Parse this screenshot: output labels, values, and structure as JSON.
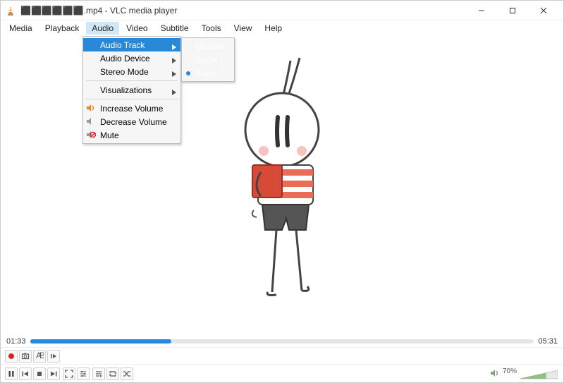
{
  "titlebar": {
    "filename_masked": "⬛⬛⬛⬛⬛⬛.mp4",
    "app_name": "VLC media player"
  },
  "menus": {
    "items": [
      "Media",
      "Playback",
      "Audio",
      "Video",
      "Subtitle",
      "Tools",
      "View",
      "Help"
    ],
    "open_index": 2
  },
  "audio_menu": {
    "items": [
      {
        "label": "Audio Track",
        "submenu": true,
        "highlight": true,
        "icon": null
      },
      {
        "label": "Audio Device",
        "submenu": true,
        "icon": null
      },
      {
        "label": "Stereo Mode",
        "submenu": true,
        "icon": null
      },
      {
        "sep": true
      },
      {
        "label": "Visualizations",
        "submenu": true,
        "icon": null
      },
      {
        "sep": true
      },
      {
        "label": "Increase Volume",
        "icon": "volume-up"
      },
      {
        "label": "Decrease Volume",
        "icon": "volume-down"
      },
      {
        "label": "Mute",
        "icon": "mute"
      }
    ]
  },
  "audio_track_submenu": {
    "items": [
      {
        "label": "Disable",
        "selected": false
      },
      {
        "label": "Track 1",
        "selected": false
      },
      {
        "label": "Track 2",
        "selected": true
      }
    ]
  },
  "playback": {
    "elapsed": "01:33",
    "total": "05:31",
    "progress_ratio": 0.281
  },
  "volume": {
    "percent_label": "70%",
    "value_ratio": 0.7
  },
  "colors": {
    "highlight": "#2989d8",
    "record": "#d22"
  }
}
